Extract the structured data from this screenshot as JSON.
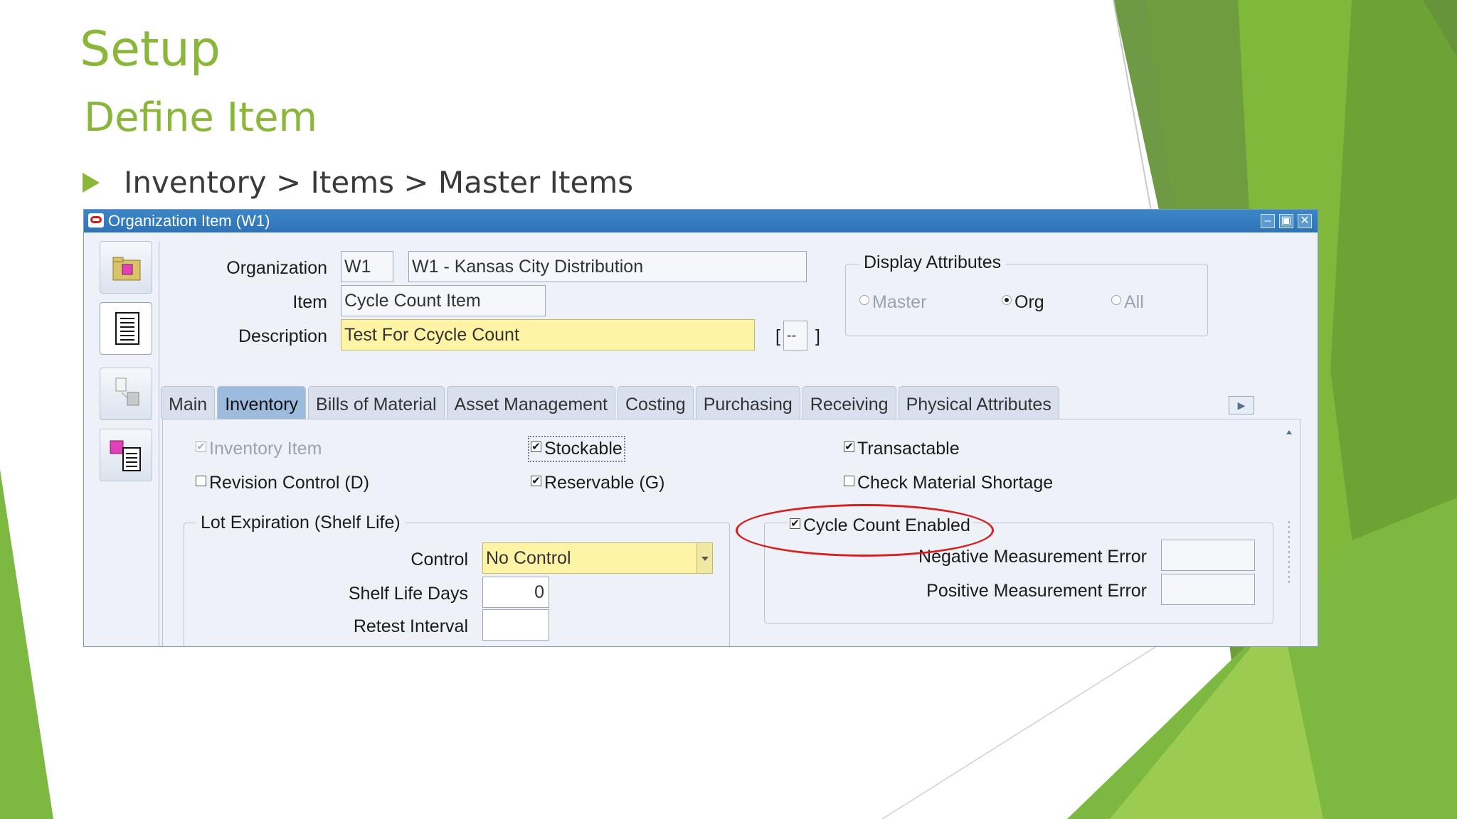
{
  "slide": {
    "title": "Setup",
    "subtitle": "Define Item",
    "bullet": "Inventory > Items > Master Items",
    "accent_color": "#8ab63a"
  },
  "window": {
    "title": "Organization Item (W1)",
    "controls": [
      "minimize-icon",
      "maximize-icon",
      "close-icon"
    ]
  },
  "toolbar": {
    "icons": [
      "open-folder-icon",
      "list-document-icon",
      "copy-items-icon",
      "item-attributes-icon"
    ]
  },
  "form": {
    "organization_label": "Organization",
    "organization_code": "W1",
    "organization_name": "W1 - Kansas City Distribution",
    "item_label": "Item",
    "item_value": "Cycle Count Item",
    "description_label": "Description",
    "description_value": "Test For Ccycle Count",
    "flex_open": "[",
    "flex_value": "--",
    "flex_close": "]"
  },
  "display_attributes": {
    "title": "Display Attributes",
    "options": [
      "Master",
      "Org",
      "All"
    ],
    "selected": "Org"
  },
  "tabs": {
    "items": [
      "Main",
      "Inventory",
      "Bills of Material",
      "Asset Management",
      "Costing",
      "Purchasing",
      "Receiving",
      "Physical Attributes"
    ],
    "active": "Inventory"
  },
  "inventory_tab": {
    "inventory_item": "Inventory Item",
    "stockable": "Stockable",
    "transactable": "Transactable",
    "revision_control": "Revision Control (D)",
    "reservable": "Reservable (G)",
    "check_material_shortage": "Check Material Shortage",
    "lot_expiration": {
      "title": "Lot Expiration (Shelf Life)",
      "control_label": "Control",
      "control_value": "No Control",
      "shelf_life_label": "Shelf Life Days",
      "shelf_life_value": "0",
      "retest_label": "Retest Interval",
      "retest_value": ""
    },
    "cycle_count": {
      "enabled_label": "Cycle Count Enabled",
      "negative_label": "Negative Measurement Error",
      "negative_value": "",
      "positive_label": "Positive Measurement Error",
      "positive_value": ""
    },
    "checked": {
      "inventory_item": true,
      "stockable": true,
      "transactable": true,
      "revision_control": false,
      "reservable": true,
      "check_material_shortage": false,
      "cycle_count_enabled": true
    }
  },
  "highlight_color": "#d62020"
}
